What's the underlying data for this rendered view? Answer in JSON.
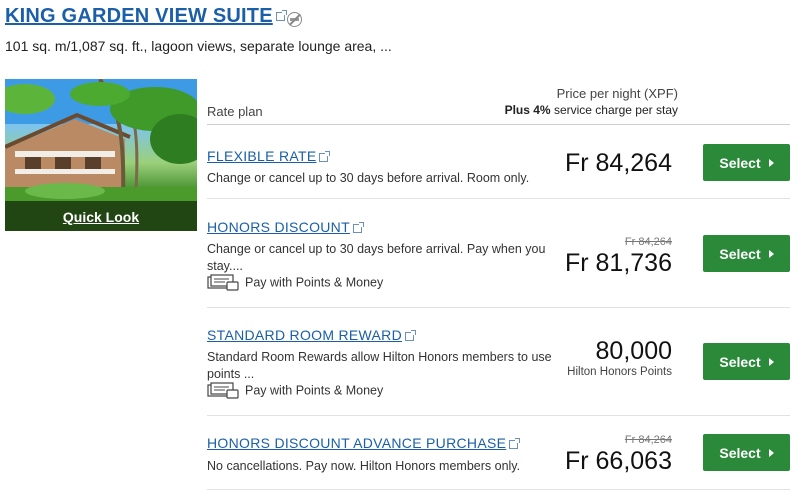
{
  "suite": {
    "title": "KING GARDEN VIEW SUITE",
    "description": "101 sq. m/1,087 sq. ft., lagoon views, separate lounge area, ...",
    "quick_look": "Quick Look"
  },
  "table_header": {
    "rate_plan": "Rate plan",
    "price_per_night": "Price per night (XPF)",
    "service_prefix": "Plus",
    "service_percent": "4%",
    "service_suffix": "service charge per stay"
  },
  "rates": [
    {
      "name": "FLEXIBLE RATE",
      "description": "Change or cancel up to 30 days before arrival. Room only.",
      "price": "Fr 84,264",
      "select_label": "Select"
    },
    {
      "name": "HONORS DISCOUNT",
      "description": "Change or cancel up to 30 days before arrival. Pay when you stay....",
      "points_money": "Pay with Points & Money",
      "original_price": "Fr 84,264",
      "price": "Fr 81,736",
      "select_label": "Select"
    },
    {
      "name": "STANDARD ROOM REWARD",
      "description": "Standard Room Rewards allow Hilton Honors members to use points ...",
      "points_money": "Pay with Points & Money",
      "price": "80,000",
      "price_unit": "Hilton Honors Points",
      "select_label": "Select"
    },
    {
      "name": "HONORS DISCOUNT ADVANCE PURCHASE",
      "description": "No cancellations. Pay now. Hilton Honors members only.",
      "original_price": "Fr 84,264",
      "price": "Fr 66,063",
      "select_label": "Select"
    }
  ],
  "colors": {
    "link": "#1a5fa8",
    "select_button": "#2a8a3a"
  },
  "icons": [
    "external-link-icon",
    "no-smoking-icon",
    "points-money-icon",
    "chevron-right-icon"
  ]
}
